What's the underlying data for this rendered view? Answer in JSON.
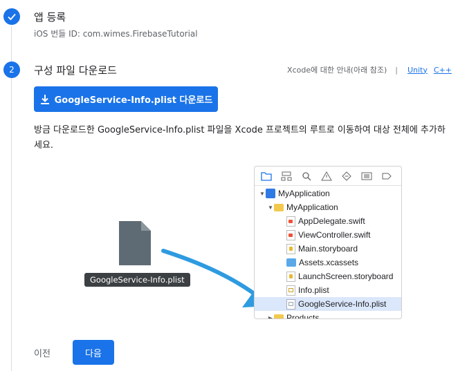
{
  "step1": {
    "icon": "check-icon",
    "title": "앱 등록",
    "subtitle": "iOS 번들 ID: com.wimes.FirebaseTutorial"
  },
  "step2": {
    "number": "2",
    "title": "구성 파일 다운로드",
    "help_text": "Xcode에 대한 안내(아래 참조)",
    "separator": "|",
    "link_unity": "Unity",
    "link_cpp": "C++",
    "download_label": "GoogleService-Info.plist 다운로드",
    "description": "방금 다운로드한 GoogleService-Info.plist 파일을 Xcode 프로젝트의 루트로 이동하여 대상 전체에 추가하세요.",
    "file_label": "GoogleService-Info.plist"
  },
  "xcode": {
    "toolbar_icons": [
      "folder-icon",
      "hierarchy-icon",
      "search-icon",
      "warning-icon",
      "diamond-icon",
      "list-icon",
      "label-icon"
    ],
    "tree": [
      {
        "label": "MyApplication",
        "type": "proj",
        "expanded": true
      },
      {
        "label": "MyApplication",
        "type": "folder",
        "expanded": true
      },
      {
        "label": "AppDelegate.swift",
        "type": "swift"
      },
      {
        "label": "ViewController.swift",
        "type": "swift"
      },
      {
        "label": "Main.storyboard",
        "type": "sb"
      },
      {
        "label": "Assets.xcassets",
        "type": "assets"
      },
      {
        "label": "LaunchScreen.storyboard",
        "type": "sb"
      },
      {
        "label": "Info.plist",
        "type": "plist"
      },
      {
        "label": "GoogleService-Info.plist",
        "type": "gplist",
        "selected": true
      },
      {
        "label": "Products",
        "type": "folder",
        "expanded": false
      }
    ]
  },
  "footer": {
    "prev_label": "이전",
    "next_label": "다음"
  },
  "colors": {
    "accent": "#1a73e8",
    "file_icon": "#5f6b74",
    "arrow": "#2e9be0"
  }
}
